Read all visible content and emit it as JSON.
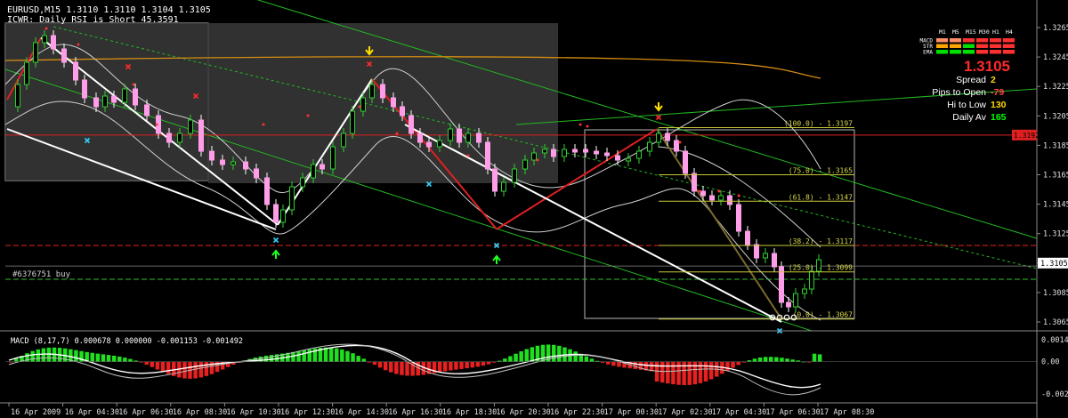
{
  "window": {
    "header_line1": "EURUSD,M15  1.3110 1.3110 1.3104 1.3105",
    "header_line2": "ICWR: Daily RSI is Short 45.3591",
    "order_label": "#6376751 buy",
    "current_price": "1.3105",
    "hline_tag": "1.3192"
  },
  "dashboard": {
    "columns": [
      "M1",
      "M5",
      "M15",
      "M30",
      "H1",
      "H4"
    ],
    "rows": [
      {
        "label": "MACD",
        "colors": [
          "#ff8f66",
          "#ff8f66",
          "#ff3030",
          "#ff3030",
          "#ff3030",
          "#ff3030"
        ]
      },
      {
        "label": "STR",
        "colors": [
          "#ffa500",
          "#ffa500",
          "#00e000",
          "#ff3030",
          "#ff3030",
          "#ff3030"
        ]
      },
      {
        "label": "EMA",
        "colors": [
          "#00e000",
          "#00e000",
          "#00e000",
          "#ff3030",
          "#ff3030",
          "#ff3030"
        ]
      }
    ],
    "big_price": "1.3105",
    "stats": [
      {
        "label": "Spread",
        "value": "2",
        "color": "#ffd700"
      },
      {
        "label": "Pips to Open",
        "value": "-79",
        "color": "#ff4040"
      },
      {
        "label": "Hi to Low",
        "value": "130",
        "color": "#ffd700"
      },
      {
        "label": "Daily Av",
        "value": "165",
        "color": "#00ff00"
      }
    ]
  },
  "chart_data": [
    {
      "type": "candlestick",
      "symbol": "EURUSD",
      "timeframe": "M15",
      "ylim": [
        1.3055,
        1.3275
      ],
      "y_ticks": [
        "1.3265",
        "1.3245",
        "1.3225",
        "1.3205",
        "1.3185",
        "1.3165",
        "1.3145",
        "1.3125",
        "1.3105",
        "1.3085",
        "1.3065"
      ],
      "x_ticks": [
        "16 Apr 2009",
        "16 Apr 04:30",
        "16 Apr 06:30",
        "16 Apr 08:30",
        "16 Apr 10:30",
        "16 Apr 12:30",
        "16 Apr 14:30",
        "16 Apr 16:30",
        "16 Apr 18:30",
        "16 Apr 20:30",
        "16 Apr 22:30",
        "17 Apr 00:30",
        "17 Apr 02:30",
        "17 Apr 04:30",
        "17 Apr 06:30",
        "17 Apr 08:30"
      ],
      "zigzag_points": [
        1.3258,
        1.3131,
        1.323,
        1.3128,
        1.3196,
        1.3067
      ],
      "fibonacci": [
        {
          "label": "(100.0) - 1.3197",
          "level": 1.3197
        },
        {
          "label": "(75.0) - 1.3165",
          "level": 1.3165
        },
        {
          "label": "(61.8) - 1.3147",
          "level": 1.3147
        },
        {
          "label": "(38.2) - 1.3117",
          "level": 1.3117
        },
        {
          "label": "(25.0) - 1.3099",
          "level": 1.3099
        },
        {
          "label": "(0.0) - 1.3067",
          "level": 1.3067
        }
      ],
      "horizontal_lines": [
        {
          "name": "resistance",
          "level": 1.3192,
          "color": "#e02020"
        },
        {
          "name": "order",
          "level": 1.3103,
          "color": "#8a8a8a"
        },
        {
          "name": "stop",
          "level": 1.3117,
          "color": "#e02020"
        },
        {
          "name": "green-dashed",
          "level": 1.3094,
          "color": "#2ec02e"
        }
      ]
    },
    {
      "type": "bar",
      "title": "MACD (8,17,7) 0.000678 0.000000 -0.001153 -0.001492",
      "ylim": [
        -0.0021,
        0.0016
      ],
      "y_ticks": [
        "0.00141",
        "0.00",
        "-0.00208"
      ]
    }
  ]
}
